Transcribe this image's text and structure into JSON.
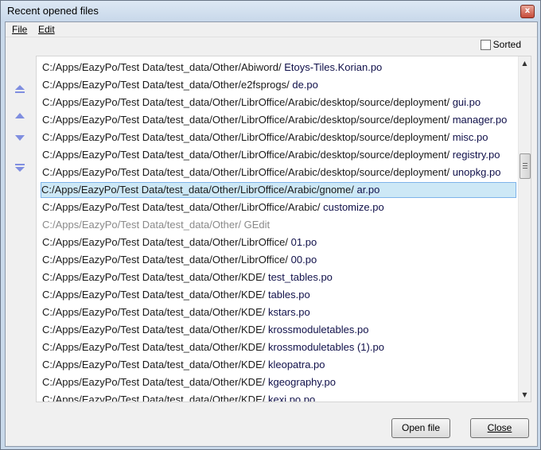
{
  "window": {
    "title": "Recent opened files",
    "close_glyph": "x"
  },
  "menu": [
    {
      "label": "File"
    },
    {
      "label": "Edit"
    }
  ],
  "sorted_label": "Sorted",
  "icons": {
    "move_top": "move-to-top-icon",
    "move_up": "move-up-icon",
    "move_down": "move-down-icon",
    "move_bottom": "move-to-bottom-icon"
  },
  "files": [
    {
      "dir": "C:/Apps/EazyPo/Test Data/test_data/Other/Abiword/ ",
      "file": "Etoys-Tiles.Korian.po",
      "state": "normal"
    },
    {
      "dir": "C:/Apps/EazyPo/Test Data/test_data/Other/e2fsprogs/ ",
      "file": "de.po",
      "state": "normal"
    },
    {
      "dir": "C:/Apps/EazyPo/Test Data/test_data/Other/LibrOffice/Arabic/desktop/source/deployment/ ",
      "file": "gui.po",
      "state": "normal"
    },
    {
      "dir": "C:/Apps/EazyPo/Test Data/test_data/Other/LibrOffice/Arabic/desktop/source/deployment/ ",
      "file": "manager.po",
      "state": "normal"
    },
    {
      "dir": "C:/Apps/EazyPo/Test Data/test_data/Other/LibrOffice/Arabic/desktop/source/deployment/ ",
      "file": "misc.po",
      "state": "normal"
    },
    {
      "dir": "C:/Apps/EazyPo/Test Data/test_data/Other/LibrOffice/Arabic/desktop/source/deployment/ ",
      "file": "registry.po",
      "state": "normal"
    },
    {
      "dir": "C:/Apps/EazyPo/Test Data/test_data/Other/LibrOffice/Arabic/desktop/source/deployment/ ",
      "file": "unopkg.po",
      "state": "normal"
    },
    {
      "dir": "C:/Apps/EazyPo/Test Data/test_data/Other/LibrOffice/Arabic/gnome/ ",
      "file": "ar.po",
      "state": "selected"
    },
    {
      "dir": "C:/Apps/EazyPo/Test Data/test_data/Other/LibrOffice/Arabic/ ",
      "file": "customize.po",
      "state": "normal"
    },
    {
      "dir": "C:/Apps/EazyPo/Test Data/test_data/Other/ ",
      "file": "GEdit",
      "state": "disabled"
    },
    {
      "dir": "C:/Apps/EazyPo/Test Data/test_data/Other/LibrOffice/ ",
      "file": "01.po",
      "state": "normal"
    },
    {
      "dir": "C:/Apps/EazyPo/Test Data/test_data/Other/LibrOffice/ ",
      "file": "00.po",
      "state": "normal"
    },
    {
      "dir": "C:/Apps/EazyPo/Test Data/test_data/Other/KDE/ ",
      "file": "test_tables.po",
      "state": "normal"
    },
    {
      "dir": "C:/Apps/EazyPo/Test Data/test_data/Other/KDE/ ",
      "file": "tables.po",
      "state": "normal"
    },
    {
      "dir": "C:/Apps/EazyPo/Test Data/test_data/Other/KDE/ ",
      "file": "kstars.po",
      "state": "normal"
    },
    {
      "dir": "C:/Apps/EazyPo/Test Data/test_data/Other/KDE/ ",
      "file": "krossmoduletables.po",
      "state": "normal"
    },
    {
      "dir": "C:/Apps/EazyPo/Test Data/test_data/Other/KDE/ ",
      "file": "krossmoduletables (1).po",
      "state": "normal"
    },
    {
      "dir": "C:/Apps/EazyPo/Test Data/test_data/Other/KDE/ ",
      "file": "kleopatra.po",
      "state": "normal"
    },
    {
      "dir": "C:/Apps/EazyPo/Test Data/test_data/Other/KDE/ ",
      "file": "kgeography.po",
      "state": "normal"
    },
    {
      "dir": "C:/Apps/EazyPo/Test Data/test_data/Other/KDE/ ",
      "file": "kexi.po.po",
      "state": "normal"
    }
  ],
  "buttons": {
    "open_file": "Open file",
    "close": "Close"
  }
}
